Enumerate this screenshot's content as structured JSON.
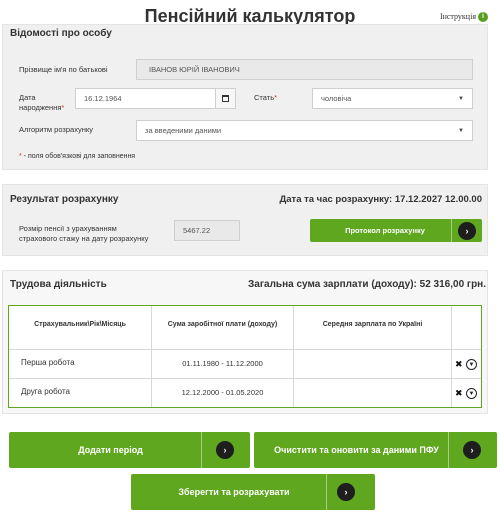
{
  "header": {
    "title": "Пенсійний калькулятор",
    "help_label": "Інструкція",
    "help_icon": "info-icon"
  },
  "personal": {
    "section_title": "Відомості про особу",
    "name_label": "Прізвище ім'я по батькові",
    "name_value": "ІВАНОВ ЮРІЙ ІВАНОВИЧ",
    "birth_label_line1": "Дата",
    "birth_label_line2": "народження",
    "birth_value": "16.12.1964",
    "sex_label": "Стать",
    "sex_value": "чоловіча",
    "algo_label": "Алгоритм розрахунку",
    "algo_value": "за введеними даними",
    "required_mark": "*",
    "required_note": " - поля обов'язкові для заповнення"
  },
  "result": {
    "section_title": "Результат розрахунку",
    "datetime_text": "Дата та час розрахунку: 17.12.2027 12.00.00",
    "pension_label_line1": "Розмір пенсії з урахуванням",
    "pension_label_line2": "страхового стажу на дату розрахунку",
    "pension_value": "5467.22",
    "protocol_button": "Протокол розрахунку"
  },
  "work": {
    "section_title": "Трудова діяльність",
    "total_text": "Загальна сума зарплати (доходу): 52 316,00 грн.",
    "columns": [
      "Страхувальник\\Рік\\Місяць",
      "Сума заробітної плати (доходу)",
      "Середня зарплата по Україні"
    ],
    "rows": [
      {
        "name": "Перша робота",
        "period": "01.11.1980 - 11.12.2000"
      },
      {
        "name": "Друга робота",
        "period": "12.12.2000 - 01.05.2020"
      }
    ]
  },
  "actions": {
    "add_period": "Додати період",
    "clear_update": "Очистити та оновити за даними ПФУ",
    "save_calc": "Зберегти та розрахувати"
  },
  "colors": {
    "accent_green": "#5fa71e",
    "panel_bg": "#f0f0f0"
  }
}
